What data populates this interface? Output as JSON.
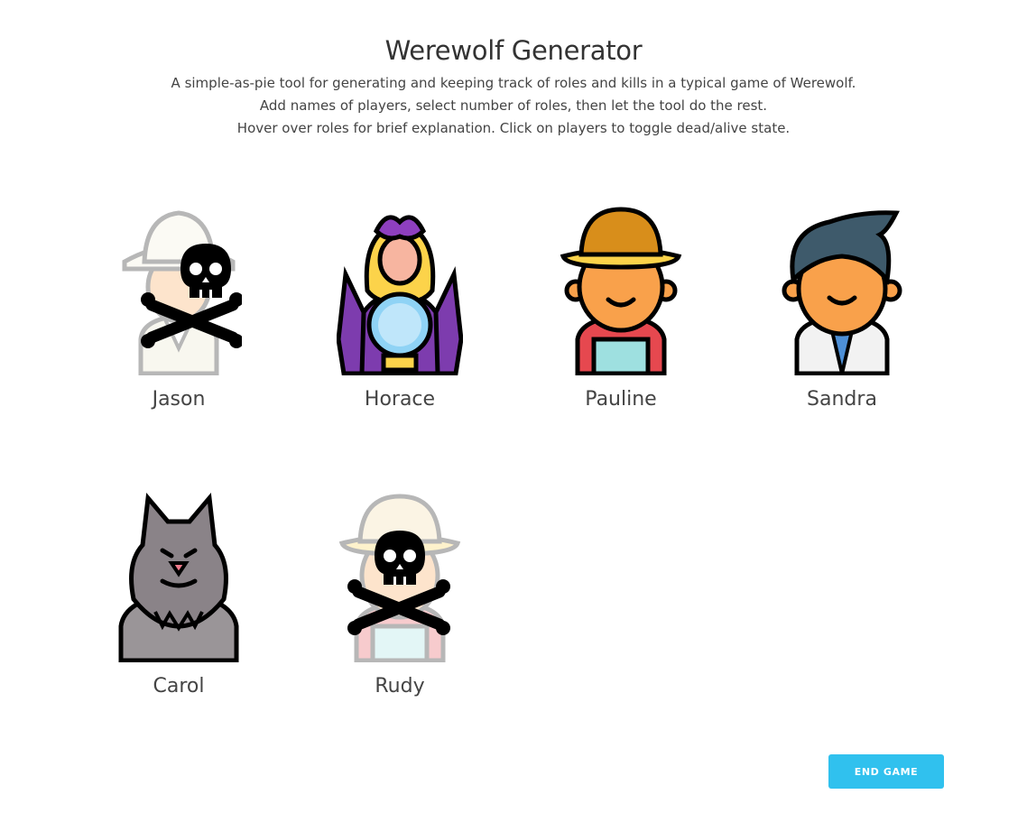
{
  "header": {
    "title": "Werewolf Generator",
    "description": [
      "A simple-as-pie tool for generating and keeping track of roles and kills in a typical game of Werewolf.",
      "Add names of players, select number of roles, then let the tool do the rest.",
      "Hover over roles for brief explanation. Click on players to toggle dead/alive state."
    ]
  },
  "players": [
    {
      "name": "Jason",
      "role_icon": "explorer-icon",
      "state": "dead"
    },
    {
      "name": "Horace",
      "role_icon": "fortune-teller-icon",
      "state": "alive"
    },
    {
      "name": "Pauline",
      "role_icon": "farmer-icon",
      "state": "alive"
    },
    {
      "name": "Sandra",
      "role_icon": "doctor-icon",
      "state": "alive"
    },
    {
      "name": "Carol",
      "role_icon": "werewolf-icon",
      "state": "alive"
    },
    {
      "name": "Rudy",
      "role_icon": "farmer-icon",
      "state": "dead"
    }
  ],
  "actions": {
    "end_game_label": "END GAME"
  },
  "colors": {
    "accent": "#30c1ee",
    "skin": "#f9a14b",
    "outline": "#000000"
  }
}
